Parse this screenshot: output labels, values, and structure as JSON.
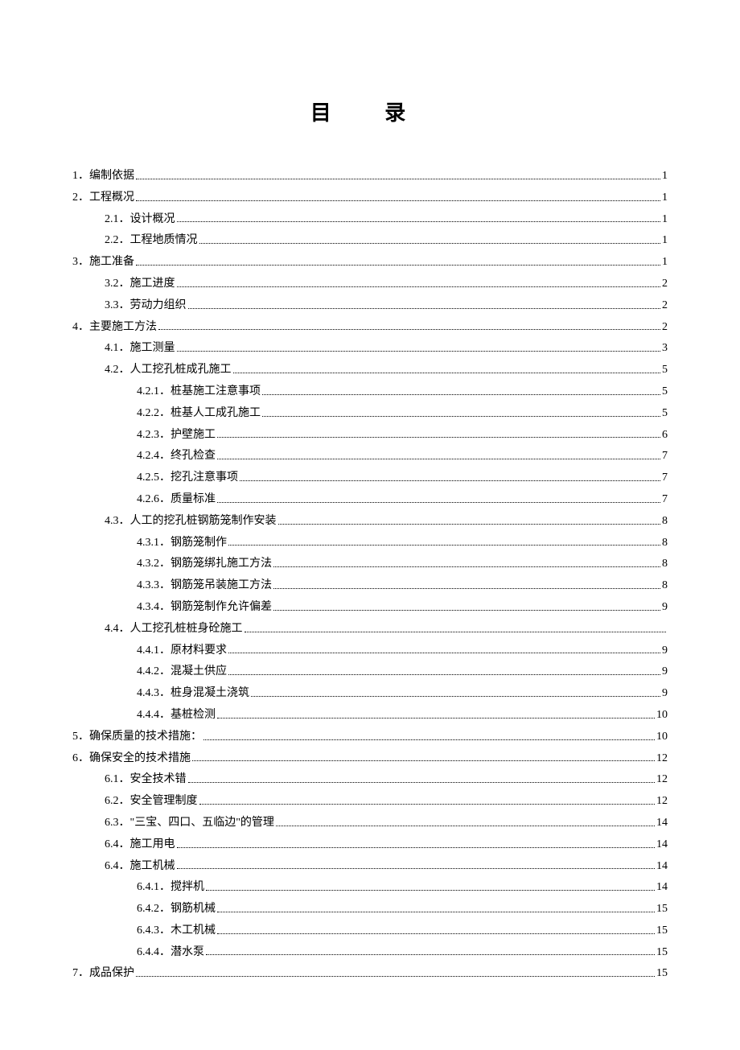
{
  "title": "目  录",
  "entries": [
    {
      "level": 1,
      "label": "1．编制依据",
      "page": "1"
    },
    {
      "level": 1,
      "label": "2．工程概况",
      "page": "1"
    },
    {
      "level": 2,
      "label": "2.1．设计概况",
      "page": "1"
    },
    {
      "level": 2,
      "label": "2.2．工程地质情况",
      "page": "1"
    },
    {
      "level": 1,
      "label": "3．施工准备",
      "page": "1"
    },
    {
      "level": 2,
      "label": "3.2．施工进度",
      "page": "2"
    },
    {
      "level": 2,
      "label": "3.3．劳动力组织",
      "page": "2"
    },
    {
      "level": 1,
      "label": "4．主要施工方法",
      "page": "2"
    },
    {
      "level": 2,
      "label": "4.1．施工测量",
      "page": "3"
    },
    {
      "level": 2,
      "label": "4.2．人工挖孔桩成孔施工",
      "page": "5"
    },
    {
      "level": 3,
      "label": "4.2.1．桩基施工注意事项",
      "page": "5"
    },
    {
      "level": 3,
      "label": "4.2.2．桩基人工成孔施工",
      "page": "5"
    },
    {
      "level": 3,
      "label": "4.2.3．护壁施工",
      "page": "6"
    },
    {
      "level": 3,
      "label": "4.2.4．终孔检查",
      "page": "7"
    },
    {
      "level": 3,
      "label": "4.2.5．挖孔注意事项",
      "page": "7"
    },
    {
      "level": 3,
      "label": "4.2.6．质量标准",
      "page": "7"
    },
    {
      "level": 2,
      "label": "4.3．人工的挖孔桩钢筋笼制作安装",
      "page": "8"
    },
    {
      "level": 3,
      "label": "4.3.1．钢筋笼制作",
      "page": "8"
    },
    {
      "level": 3,
      "label": "4.3.2．钢筋笼绑扎施工方法",
      "page": "8"
    },
    {
      "level": 3,
      "label": "4.3.3．钢筋笼吊装施工方法",
      "page": "8"
    },
    {
      "level": 3,
      "label": "4.3.4．钢筋笼制作允许偏差",
      "page": "9"
    },
    {
      "level": 2,
      "label": "4.4．人工挖孔桩桩身砼施工",
      "page": ""
    },
    {
      "level": 3,
      "label": "4.4.1．原材料要求",
      "page": "9"
    },
    {
      "level": 3,
      "label": "4.4.2．混凝土供应",
      "page": "9"
    },
    {
      "level": 3,
      "label": "4.4.3．桩身混凝土浇筑",
      "page": "9"
    },
    {
      "level": 3,
      "label": "4.4.4．基桩检测",
      "page": "10"
    },
    {
      "level": 1,
      "label": "5．确保质量的技术措施：",
      "page": "10"
    },
    {
      "level": 1,
      "label": "6．确保安全的技术措施",
      "page": "12"
    },
    {
      "level": 2,
      "label": "6.1．安全技术错",
      "page": "12"
    },
    {
      "level": 2,
      "label": "6.2．安全管理制度",
      "page": "12"
    },
    {
      "level": 2,
      "label": "6.3．\"三宝、四口、五临边\"的管理",
      "page": "14"
    },
    {
      "level": 2,
      "label": "6.4．施工用电",
      "page": "14"
    },
    {
      "level": 2,
      "label": "6.4．施工机械",
      "page": "14"
    },
    {
      "level": 3,
      "label": "6.4.1．搅拌机",
      "page": "14"
    },
    {
      "level": 3,
      "label": "6.4.2．钢筋机械",
      "page": "15"
    },
    {
      "level": 3,
      "label": "6.4.3．木工机械",
      "page": "15"
    },
    {
      "level": 3,
      "label": "6.4.4．潜水泵",
      "page": "15"
    },
    {
      "level": 1,
      "label": "7．成品保护",
      "page": "15"
    }
  ]
}
